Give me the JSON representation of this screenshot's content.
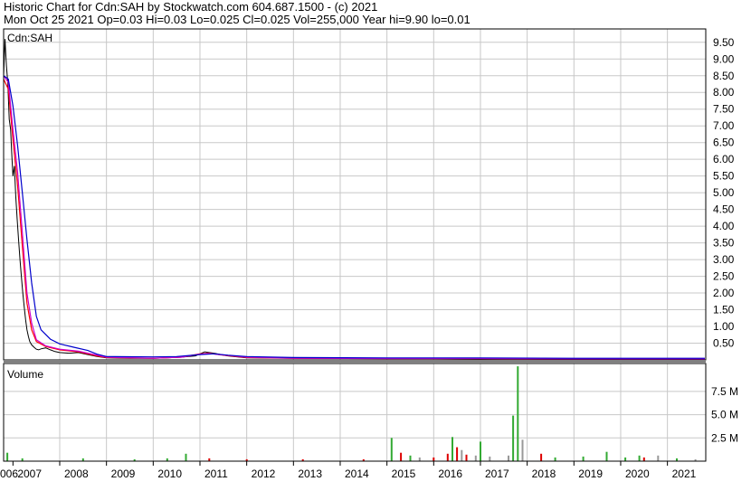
{
  "header": {
    "line1": "Historic Chart for Cdn:SAH by Stockwatch.com 604.687.1500 - (c) 2021",
    "line2": "Mon Oct 25 2021   Op=0.03   Hi=0.03   Lo=0.025   Cl=0.025   Vol=255,000   Year hi=9.90   lo=0.01"
  },
  "colors": {
    "price": "#000000",
    "ma_fast": "#ff0000",
    "ma_mid": "#cc00cc",
    "ma_slow": "#0000cc",
    "volume_up": "#33aa33",
    "volume_down": "#dd0000",
    "volume_flat": "#999999",
    "grid": "#c8c8c8"
  },
  "chart_data": [
    {
      "type": "line",
      "panel": "price",
      "legend": "Cdn:SAH",
      "y_ticks": [
        "9.50",
        "9.00",
        "8.50",
        "8.00",
        "7.50",
        "7.00",
        "6.50",
        "6.00",
        "5.50",
        "5.00",
        "4.50",
        "4.00",
        "3.50",
        "3.00",
        "2.50",
        "2.00",
        "1.50",
        "1.00",
        "0.50"
      ],
      "ylim": [
        0,
        9.9
      ],
      "x_ticks": [
        "006",
        "2007",
        "2008",
        "2009",
        "2010",
        "2011",
        "2012",
        "2013",
        "2014",
        "2015",
        "2016",
        "2017",
        "2018",
        "2019",
        "2020",
        "2021"
      ],
      "xlim": [
        2006.8,
        2021.82
      ],
      "grid": true,
      "series": [
        {
          "role": "price",
          "x": [
            2006.8,
            2006.83,
            2006.86,
            2006.89,
            2006.92,
            2006.95,
            2006.98,
            2007.0,
            2007.03,
            2007.06,
            2007.09,
            2007.12,
            2007.15,
            2007.18,
            2007.21,
            2007.24,
            2007.27,
            2007.3,
            2007.33,
            2007.36,
            2007.4,
            2007.45,
            2007.5,
            2007.55,
            2007.6,
            2007.7,
            2007.8,
            2007.9,
            2008.0,
            2008.2,
            2008.4,
            2008.6,
            2008.8,
            2009.0,
            2009.5,
            2010.0,
            2010.3,
            2010.6,
            2010.9,
            2011.1,
            2011.3,
            2011.6,
            2012.0,
            2013.0,
            2014.0,
            2015.0,
            2016.0,
            2017.0,
            2018.0,
            2019.0,
            2020.0,
            2021.0,
            2021.8
          ],
          "y": [
            8.5,
            9.6,
            8.8,
            8.3,
            7.2,
            6.9,
            6.0,
            5.5,
            5.8,
            4.9,
            4.2,
            3.6,
            3.0,
            2.5,
            2.0,
            1.6,
            1.2,
            0.9,
            0.7,
            0.55,
            0.45,
            0.38,
            0.32,
            0.3,
            0.33,
            0.36,
            0.3,
            0.25,
            0.22,
            0.2,
            0.22,
            0.16,
            0.1,
            0.06,
            0.05,
            0.05,
            0.06,
            0.08,
            0.12,
            0.24,
            0.2,
            0.12,
            0.06,
            0.05,
            0.04,
            0.04,
            0.04,
            0.03,
            0.04,
            0.03,
            0.03,
            0.03,
            0.025
          ]
        },
        {
          "role": "moving-average-fast",
          "x": [
            2006.8,
            2006.9,
            2007.0,
            2007.1,
            2007.2,
            2007.3,
            2007.4,
            2007.5,
            2007.7,
            2008.0,
            2008.4,
            2008.8,
            2009.0,
            2010.0,
            2010.6,
            2011.0,
            2011.2,
            2011.5,
            2012.0,
            2013.0,
            2015.0,
            2017.0,
            2019.0,
            2021.8
          ],
          "y": [
            8.4,
            8.1,
            6.6,
            5.2,
            3.4,
            1.7,
            0.9,
            0.55,
            0.4,
            0.3,
            0.24,
            0.12,
            0.07,
            0.05,
            0.08,
            0.18,
            0.2,
            0.14,
            0.07,
            0.05,
            0.04,
            0.04,
            0.03,
            0.03
          ]
        },
        {
          "role": "moving-average-mid",
          "x": [
            2006.8,
            2006.9,
            2007.0,
            2007.1,
            2007.2,
            2007.3,
            2007.4,
            2007.5,
            2007.7,
            2008.0,
            2008.4,
            2008.8,
            2009.0,
            2010.0,
            2010.6,
            2011.0,
            2011.2,
            2011.5,
            2012.0,
            2013.0,
            2015.0,
            2017.0,
            2019.0,
            2021.8
          ],
          "y": [
            8.5,
            8.3,
            6.9,
            5.6,
            3.8,
            2.0,
            1.1,
            0.6,
            0.42,
            0.32,
            0.26,
            0.14,
            0.08,
            0.05,
            0.08,
            0.17,
            0.19,
            0.15,
            0.08,
            0.05,
            0.04,
            0.04,
            0.03,
            0.03
          ]
        },
        {
          "role": "moving-average-slow",
          "x": [
            2006.8,
            2006.9,
            2007.0,
            2007.1,
            2007.2,
            2007.3,
            2007.4,
            2007.5,
            2007.6,
            2007.8,
            2008.0,
            2008.3,
            2008.6,
            2008.8,
            2009.0,
            2010.0,
            2010.5,
            2011.0,
            2011.3,
            2011.6,
            2012.0,
            2013.0,
            2015.0,
            2017.0,
            2019.0,
            2021.8
          ],
          "y": [
            8.5,
            8.4,
            7.6,
            6.4,
            5.0,
            3.6,
            2.3,
            1.3,
            0.9,
            0.62,
            0.48,
            0.38,
            0.28,
            0.17,
            0.1,
            0.09,
            0.1,
            0.16,
            0.18,
            0.14,
            0.1,
            0.07,
            0.06,
            0.06,
            0.05,
            0.05
          ]
        }
      ]
    },
    {
      "type": "bar",
      "panel": "volume",
      "legend": "Volume",
      "y_ticks": [
        "7.5 M",
        "5.0 M",
        "2.5 M"
      ],
      "ylim": [
        0,
        10.5
      ],
      "x": [
        2006.88,
        2007.2,
        2008.5,
        2009.6,
        2010.3,
        2010.7,
        2011.2,
        2012.0,
        2013.2,
        2014.5,
        2015.1,
        2015.3,
        2015.5,
        2015.7,
        2016.0,
        2016.3,
        2016.4,
        2016.5,
        2016.6,
        2016.7,
        2016.9,
        2017.0,
        2017.2,
        2017.6,
        2017.7,
        2017.8,
        2017.9,
        2018.3,
        2018.6,
        2019.2,
        2019.7,
        2020.1,
        2020.4,
        2020.5,
        2020.8,
        2021.2,
        2021.6
      ],
      "values": [
        0.9,
        0.3,
        0.3,
        0.2,
        0.3,
        0.8,
        0.3,
        0.2,
        0.2,
        0.2,
        2.5,
        0.9,
        0.6,
        0.4,
        0.4,
        0.8,
        2.6,
        1.5,
        1.2,
        0.7,
        0.6,
        2.1,
        0.5,
        0.6,
        4.9,
        10.2,
        2.3,
        0.8,
        0.4,
        0.5,
        1.0,
        0.4,
        0.6,
        0.4,
        0.6,
        0.3,
        0.2
      ],
      "direction": [
        "up",
        "up",
        "up",
        "up",
        "up",
        "up",
        "down",
        "down",
        "down",
        "down",
        "up",
        "down",
        "up",
        "flat",
        "down",
        "down",
        "up",
        "down",
        "flat",
        "down",
        "flat",
        "up",
        "flat",
        "flat",
        "up",
        "up",
        "flat",
        "down",
        "up",
        "up",
        "up",
        "up",
        "up",
        "down",
        "flat",
        "up",
        "flat"
      ]
    }
  ]
}
